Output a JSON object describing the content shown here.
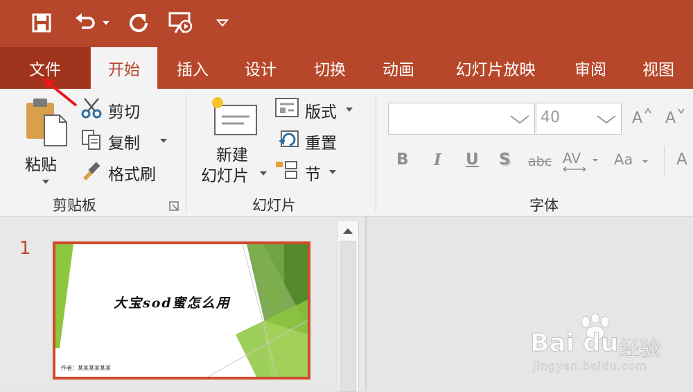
{
  "qat": {
    "icons": [
      "save-icon",
      "undo-icon",
      "dropdown-arrow-icon",
      "redo-icon",
      "slideshow-from-start-icon",
      "customize-qat-icon"
    ]
  },
  "tabs": {
    "file": "文件",
    "home": "开始",
    "insert": "插入",
    "design": "设计",
    "transitions": "切换",
    "animations": "动画",
    "slideshow": "幻灯片放映",
    "review": "审阅",
    "view": "视图"
  },
  "clipboard": {
    "paste": "粘贴",
    "cut": "剪切",
    "copy": "复制",
    "format_painter": "格式刷",
    "group": "剪贴板"
  },
  "slides": {
    "new_slide_l1": "新建",
    "new_slide_l2": "幻灯片",
    "layout": "版式",
    "reset": "重置",
    "section": "节",
    "group": "幻灯片"
  },
  "font": {
    "name_value": "",
    "size_value": "40",
    "bold": "B",
    "italic": "I",
    "underline": "U",
    "shadow": "S",
    "strikethrough": "abc",
    "spacing": "AV",
    "case": "Aa",
    "increase": "A",
    "decrease": "A",
    "clear": "A",
    "group": "字体"
  },
  "thumbnail": {
    "number": "1",
    "title": "大宝sod蜜怎么用",
    "footer": "作者：某某某某某某"
  },
  "watermark": {
    "brand_a": "Bai",
    "brand_b": "du",
    "brand_cn": "经验",
    "url": "jingyan.baidu.com"
  },
  "colors": {
    "accent": "#b7472a",
    "file_tab": "#a0331b",
    "annotation_arrow": "#e8191a",
    "slide_green": "#8dc63f"
  }
}
